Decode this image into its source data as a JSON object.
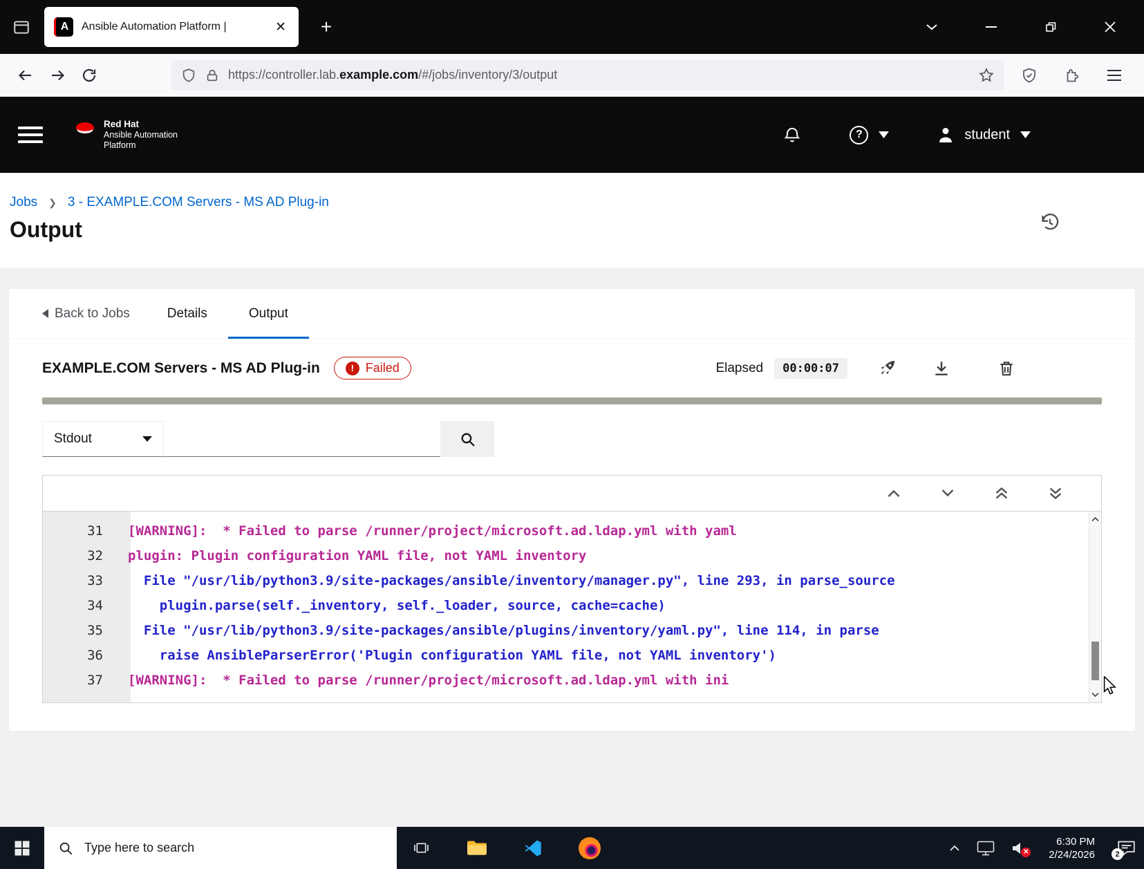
{
  "browser": {
    "tab": {
      "title": "Ansible Automation Platform |"
    },
    "new_tab_label": "+",
    "url": {
      "prefix": "https://controller.lab.",
      "domain": "example.com",
      "suffix": "/#/jobs/inventory/3/output"
    }
  },
  "app_header": {
    "brand_line1": "Red Hat",
    "brand_line2": "Ansible Automation",
    "brand_line3": "Platform",
    "help_glyph": "?",
    "user_name": "student"
  },
  "page": {
    "breadcrumb_jobs": "Jobs",
    "breadcrumb_job": "3 - EXAMPLE.COM Servers - MS AD Plug-in",
    "title": "Output"
  },
  "tabs": {
    "back": "Back to Jobs",
    "details": "Details",
    "output": "Output"
  },
  "job": {
    "name": "EXAMPLE.COM Servers - MS AD Plug-in",
    "status_label": "Failed",
    "status_glyph": "!",
    "elapsed_label": "Elapsed",
    "elapsed_value": "00:00:07"
  },
  "output_controls": {
    "filter_selected": "Stdout"
  },
  "output_lines": [
    {
      "num": "31",
      "type": "warning",
      "text": "[WARNING]:  * Failed to parse /runner/project/microsoft.ad.ldap.yml with yaml"
    },
    {
      "num": "32",
      "type": "warning",
      "text": "plugin: Plugin configuration YAML file, not YAML inventory"
    },
    {
      "num": "33",
      "type": "trace",
      "text": "  File \"/usr/lib/python3.9/site-packages/ansible/inventory/manager.py\", line 293, in parse_source"
    },
    {
      "num": "34",
      "type": "trace",
      "text": "    plugin.parse(self._inventory, self._loader, source, cache=cache)"
    },
    {
      "num": "35",
      "type": "trace",
      "text": "  File \"/usr/lib/python3.9/site-packages/ansible/plugins/inventory/yaml.py\", line 114, in parse"
    },
    {
      "num": "36",
      "type": "trace",
      "text": "    raise AnsibleParserError('Plugin configuration YAML file, not YAML inventory')"
    },
    {
      "num": "37",
      "type": "warning",
      "text": "[WARNING]:  * Failed to parse /runner/project/microsoft.ad.ldap.yml with ini"
    }
  ],
  "taskbar": {
    "search_placeholder": "Type here to search",
    "time": "6:30 PM",
    "date": "2/24/2026",
    "notification_count": "2"
  },
  "colors": {
    "accent_blue": "#0066cc",
    "failed_red": "#c9190b",
    "warning_magenta": "#b72895",
    "trace_blue": "#2222cc",
    "progress_bar": "#a3a69b"
  }
}
